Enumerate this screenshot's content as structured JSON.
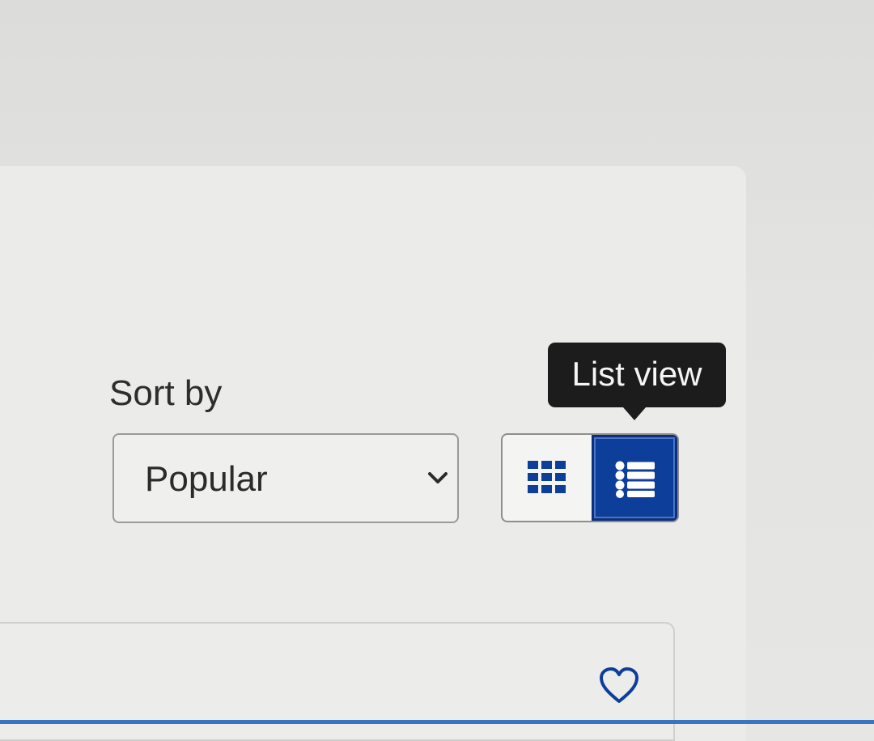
{
  "sort": {
    "label": "Sort by",
    "selected": "Popular",
    "icon": "chevron-down-icon"
  },
  "view_toggle": {
    "grid_icon": "grid-view-icon",
    "list_icon": "list-view-icon",
    "active": "list"
  },
  "tooltip": {
    "text": "List view"
  },
  "card": {
    "favorite_icon": "heart-icon"
  },
  "colors": {
    "accent": "#0d3f9a",
    "tooltip_bg": "#1c1c1c",
    "bottom_line": "#3c74c4"
  }
}
